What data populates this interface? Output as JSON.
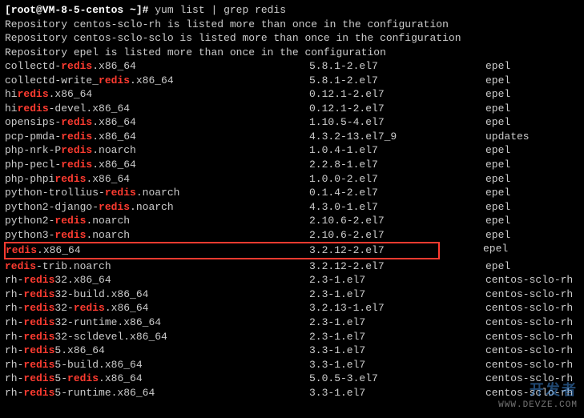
{
  "prompt": {
    "user_host": "[root@VM-8-5-centos ~]#",
    "command": "yum list | grep redis"
  },
  "messages": [
    "Repository centos-sclo-rh is listed more than once in the configuration",
    "Repository centos-sclo-sclo is listed more than once in the configuration",
    "Repository epel is listed more than once in the configuration"
  ],
  "packages": [
    {
      "pre": "collectd-",
      "hl": "redis",
      "post": ".x86_64",
      "ver": "5.8.1-2.el7",
      "repo": "epel"
    },
    {
      "pre": "collectd-write_",
      "hl": "redis",
      "post": ".x86_64",
      "ver": "5.8.1-2.el7",
      "repo": "epel"
    },
    {
      "pre": "hi",
      "hl": "redis",
      "post": ".x86_64",
      "ver": "0.12.1-2.el7",
      "repo": "epel"
    },
    {
      "pre": "hi",
      "hl": "redis",
      "post": "-devel.x86_64",
      "ver": "0.12.1-2.el7",
      "repo": "epel"
    },
    {
      "pre": "opensips-",
      "hl": "redis",
      "post": ".x86_64",
      "ver": "1.10.5-4.el7",
      "repo": "epel"
    },
    {
      "pre": "pcp-pmda-",
      "hl": "redis",
      "post": ".x86_64",
      "ver": "4.3.2-13.el7_9",
      "repo": "updates"
    },
    {
      "pre": "php-nrk-P",
      "hl": "redis",
      "post": ".noarch",
      "ver": "1.0.4-1.el7",
      "repo": "epel"
    },
    {
      "pre": "php-pecl-",
      "hl": "redis",
      "post": ".x86_64",
      "ver": "2.2.8-1.el7",
      "repo": "epel"
    },
    {
      "pre": "php-phpi",
      "hl": "redis",
      "post": ".x86_64",
      "ver": "1.0.0-2.el7",
      "repo": "epel"
    },
    {
      "pre": "python-trollius-",
      "hl": "redis",
      "post": ".noarch",
      "ver": "0.1.4-2.el7",
      "repo": "epel"
    },
    {
      "pre": "python2-django-",
      "hl": "redis",
      "post": ".noarch",
      "ver": "4.3.0-1.el7",
      "repo": "epel"
    },
    {
      "pre": "python2-",
      "hl": "redis",
      "post": ".noarch",
      "ver": "2.10.6-2.el7",
      "repo": "epel"
    },
    {
      "pre": "python3-",
      "hl": "redis",
      "post": ".noarch",
      "ver": "2.10.6-2.el7",
      "repo": "epel"
    },
    {
      "pre": "",
      "hl": "redis",
      "post": ".x86_64",
      "ver": "3.2.12-2.el7",
      "repo": "epel",
      "highlighted": true
    },
    {
      "pre": "",
      "hl": "redis",
      "post": "-trib.noarch",
      "ver": "3.2.12-2.el7",
      "repo": "epel"
    },
    {
      "pre": "rh-",
      "hl": "redis",
      "post": "32.x86_64",
      "ver": "2.3-1.el7",
      "repo": "centos-sclo-rh"
    },
    {
      "pre": "rh-",
      "hl": "redis",
      "post": "32-build.x86_64",
      "ver": "2.3-1.el7",
      "repo": "centos-sclo-rh"
    },
    {
      "pre": "rh-",
      "hl": "redis",
      "post": "32-redis.x86_64",
      "ver": "3.2.13-1.el7",
      "repo": "centos-sclo-rh",
      "hl2": "redis",
      "hl2_at": 3
    },
    {
      "pre": "rh-",
      "hl": "redis",
      "post": "32-runtime.x86_64",
      "ver": "2.3-1.el7",
      "repo": "centos-sclo-rh"
    },
    {
      "pre": "rh-",
      "hl": "redis",
      "post": "32-scldevel.x86_64",
      "ver": "2.3-1.el7",
      "repo": "centos-sclo-rh"
    },
    {
      "pre": "rh-",
      "hl": "redis",
      "post": "5.x86_64",
      "ver": "3.3-1.el7",
      "repo": "centos-sclo-rh"
    },
    {
      "pre": "rh-",
      "hl": "redis",
      "post": "5-build.x86_64",
      "ver": "3.3-1.el7",
      "repo": "centos-sclo-rh"
    },
    {
      "pre": "rh-",
      "hl": "redis",
      "post": "5-redis.x86_64",
      "ver": "5.0.5-3.el7",
      "repo": "centos-sclo-rh",
      "hl2": "redis",
      "hl2_at": 2
    },
    {
      "pre": "rh-",
      "hl": "redis",
      "post": "5-runtime.x86_64",
      "ver": "3.3-1.el7",
      "repo": "centos-sclo-rh"
    }
  ],
  "watermark": {
    "line1": "开发者",
    "line2": "WWW.DEVZE.COM"
  }
}
